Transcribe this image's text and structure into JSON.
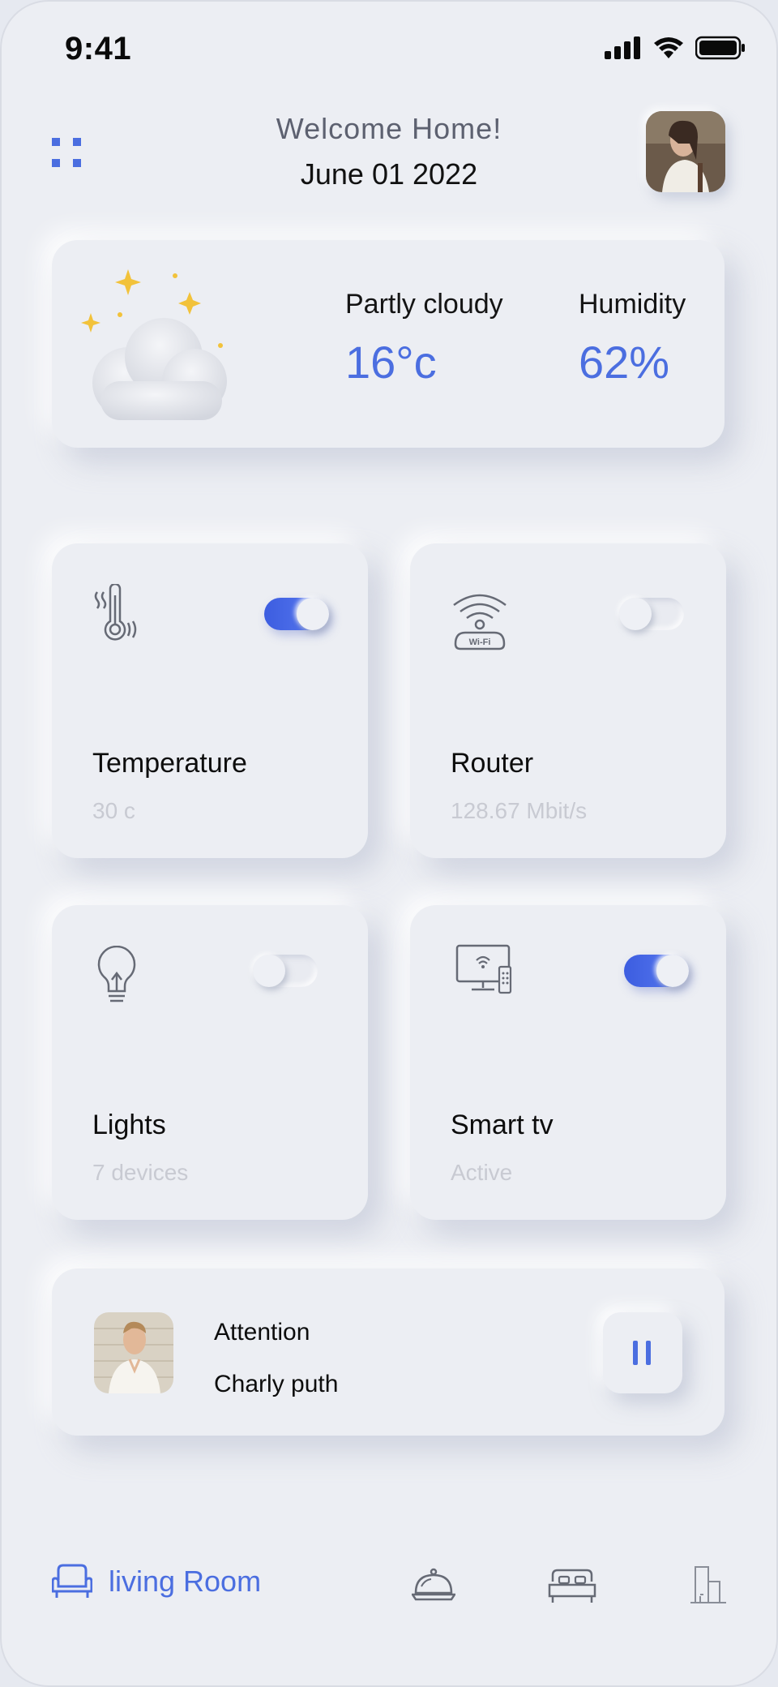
{
  "status_bar": {
    "time": "9:41"
  },
  "header": {
    "greeting": "Welcome Home!",
    "date": "June 01 2022"
  },
  "weather": {
    "condition_label": "Partly cloudy",
    "temperature": "16°c",
    "humidity_label": "Humidity",
    "humidity_value": "62%"
  },
  "devices": [
    {
      "title": "Temperature",
      "subtitle": "30 c",
      "icon": "thermometer-icon",
      "on": true
    },
    {
      "title": "Router",
      "subtitle": "128.67 Mbit/s",
      "icon": "wifi-router-icon",
      "on": false,
      "icon_text": "Wi-Fi"
    },
    {
      "title": "Lights",
      "subtitle": "7 devices",
      "icon": "light-bulb-icon",
      "on": false
    },
    {
      "title": "Smart tv",
      "subtitle": "Active",
      "icon": "smart-tv-icon",
      "on": true
    }
  ],
  "music": {
    "song": "Attention",
    "artist": "Charly puth",
    "control": "pause-icon"
  },
  "nav": {
    "active_label": "living Room",
    "items": [
      "sofa-icon",
      "cloche-icon",
      "bed-icon",
      "building-icon"
    ]
  },
  "colors": {
    "accent": "#4b6ee0",
    "background": "#eceef3",
    "sun_star": "#f2c23a",
    "moon": "#3753e6"
  }
}
